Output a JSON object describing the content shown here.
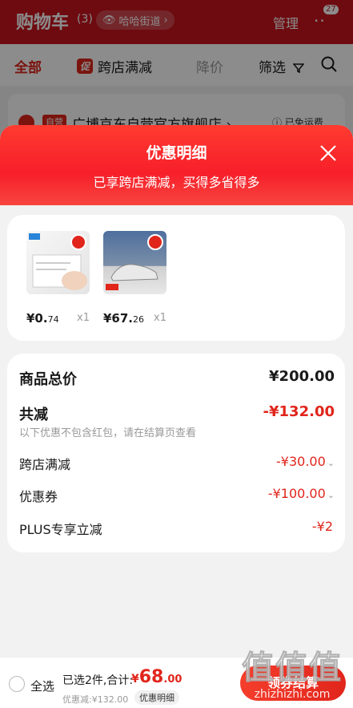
{
  "cart": {
    "title": "购物车",
    "count": "(3)",
    "location": "哈哈街道",
    "manage": "管理",
    "more": "··",
    "msg_count": "27"
  },
  "filters": {
    "all": "全部",
    "cu_badge": "促",
    "cross_store": "跨店满减",
    "price_drop": "降价",
    "filter": "筛选"
  },
  "store": {
    "badge": "自营",
    "name": "广博京东自营官方旗舰店",
    "shipping": "已免运费"
  },
  "sheet": {
    "title": "优惠明细",
    "subtitle": "已享跨店满减，买得多省得多",
    "items": [
      {
        "price_main": "¥0.",
        "price_dec": "74",
        "qty": "x1"
      },
      {
        "price_main": "¥67.",
        "price_dec": "26",
        "qty": "x1"
      }
    ],
    "summary": {
      "total_label": "商品总价",
      "total_value": "¥200.00",
      "reduce_label": "共减",
      "reduce_value": "-¥132.00",
      "note": "以下优惠不包含红包，请在结算页查看",
      "rows": [
        {
          "label": "跨店满减",
          "value": "-¥30.00"
        },
        {
          "label": "优惠券",
          "value": "-¥100.00"
        },
        {
          "label": "PLUS专享立减",
          "value": "-¥2"
        }
      ]
    }
  },
  "bottom": {
    "select_all": "全选",
    "selected_summary": "已选2件,合计:",
    "total_yen": "¥",
    "total_int": "68",
    "total_dec": ".00",
    "discount_text": "优惠减:¥132.00",
    "detail_pill": "优惠明细",
    "checkout": "领券结算"
  },
  "watermark": {
    "big": "值值值",
    "small": "zhizhizhi.com"
  },
  "colors": {
    "brand_red": "#e1251b",
    "header_red": "#c8141e"
  }
}
